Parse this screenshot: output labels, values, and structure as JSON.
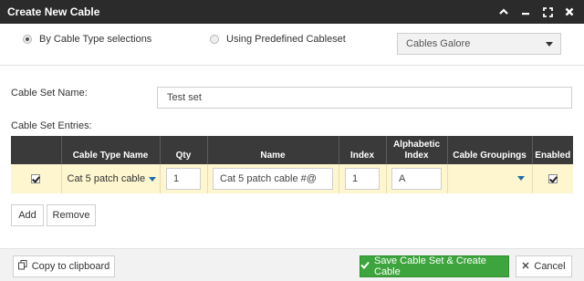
{
  "window": {
    "title": "Create New Cable"
  },
  "mode": {
    "option_cable_type": "By Cable Type selections",
    "option_predefined": "Using Predefined Cableset",
    "selected": "option_cable_type",
    "cableset_select_value": "Cables Galore"
  },
  "form": {
    "name_label": "Cable Set Name:",
    "name_value": "Test set",
    "entries_label": "Cable Set Entries:"
  },
  "table": {
    "headers": [
      "",
      "Cable Type Name",
      "Qty",
      "Name",
      "Index",
      "Alphabetic Index",
      "Cable Groupings",
      "Enabled"
    ],
    "rows": [
      {
        "selected": true,
        "cable_type": "Cat 5 patch cable",
        "qty": "1",
        "name": "Cat 5 patch cable #@",
        "index": "1",
        "alpha_index": "A",
        "grouping": "",
        "enabled": true
      }
    ]
  },
  "buttons": {
    "add": "Add",
    "remove": "Remove",
    "copy": "Copy to clipboard",
    "save": "Save Cable Set & Create Cable",
    "cancel": "Cancel"
  },
  "colors": {
    "title_bar": "#2b2b2b",
    "header_row": "#3a3a3a",
    "row_highlight": "#fdf6cf",
    "save_button": "#3ea53e",
    "caret": "#1f6ea8"
  }
}
